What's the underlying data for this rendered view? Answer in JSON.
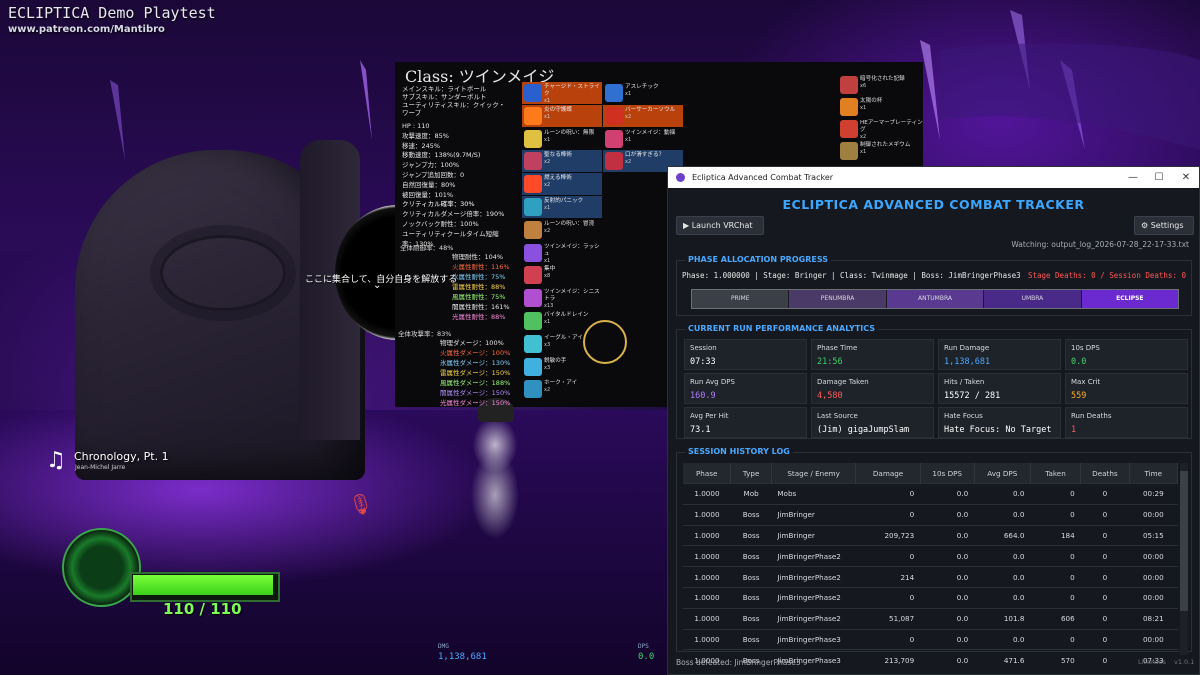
{
  "game": {
    "title": "ECLIPTICA Demo Playtest",
    "subtitle": "www.patreon.com/Mantibro",
    "class_title": "Class: ツインメイジ",
    "main_skill": "メインスキル：ライトボール",
    "sub_skill": "サブスキル：サンダーボルト",
    "utility_skill": "ユーティリティスキル：クイック・",
    "utility_skill_2": "ワープ",
    "stats": [
      "HP : 110",
      "攻撃速度：85%",
      "移速：245%",
      "移動速度：138%(9.7M/S)",
      "ジャンプ力：100%",
      "ジャンプ追加回数：0",
      "自然回復量：80%",
      "被回復量：101%",
      "クリティカル確率：30%",
      "クリティカルダメージ倍率：190%",
      "ノックバック耐性：100%",
      "ユーティリティクールタイム短縮",
      "率：130%"
    ],
    "defense_header": "全体耐御率：48%",
    "resistances": [
      {
        "label": "物理耐性：104%",
        "color": "#e6e6e6"
      },
      {
        "label": "火属性耐性：116%",
        "color": "#ff6a3d"
      },
      {
        "label": "氷属性耐性：75%",
        "color": "#7fd4ff"
      },
      {
        "label": "雷属性耐性：88%",
        "color": "#ffd94a"
      },
      {
        "label": "風属性耐性：75%",
        "color": "#9cff7a"
      },
      {
        "label": "闇属性耐性：161%",
        "color": "#e6e6e6"
      },
      {
        "label": "光属性耐性：88%",
        "color": "#ff8ae0"
      }
    ],
    "attack_header": "全体攻撃率：83%",
    "damages": [
      {
        "label": "物理ダメージ：100%",
        "color": "#e6e6e6"
      },
      {
        "label": "火属性ダメージ：100%",
        "color": "#ff6a3d"
      },
      {
        "label": "氷属性ダメージ：130%",
        "color": "#7fd4ff"
      },
      {
        "label": "雷属性ダメージ：150%",
        "color": "#ffd94a"
      },
      {
        "label": "風属性ダメージ：188%",
        "color": "#9cff7a"
      },
      {
        "label": "闇属性ダメージ：150%",
        "color": "#b08cff"
      },
      {
        "label": "光属性ダメージ：150%",
        "color": "#ff8ae0"
      }
    ],
    "sky_message": "ここに集合して、自分自身を解放する",
    "skills_left": [
      {
        "name": "チャージド・ストライク",
        "count": "x1",
        "hl": "hl-orange",
        "icon": "#2a5fd0"
      },
      {
        "name": "炎の守護蝶",
        "count": "x1",
        "hl": "hl-orange",
        "icon": "#ff7a1a"
      },
      {
        "name": "ルーンの呪い：無限",
        "count": "x1",
        "hl": "",
        "icon": "#e0c040"
      },
      {
        "name": "聖なる棒術",
        "count": "x2",
        "hl": "hl-blue",
        "icon": "#c04060"
      },
      {
        "name": "燃える棒術",
        "count": "x2",
        "hl": "hl-blue",
        "icon": "#ff4a2a"
      },
      {
        "name": "反射的パニック",
        "count": "x1",
        "hl": "hl-blue",
        "icon": "#30a0c0"
      },
      {
        "name": "ルーンの呪い：冒涜",
        "count": "x2",
        "hl": "",
        "icon": "#c08040"
      },
      {
        "name": "ツインメイジ：ラッシュ",
        "count": "x1",
        "hl": "",
        "icon": "#8a50e0"
      },
      {
        "name": "集中",
        "count": "x8",
        "hl": "",
        "icon": "#d04050"
      },
      {
        "name": "ツインメイジ：シニストラ",
        "count": "x13",
        "hl": "",
        "icon": "#b050d0"
      },
      {
        "name": "バイタルドレイン",
        "count": "x1",
        "hl": "",
        "icon": "#50c060"
      },
      {
        "name": "イーグル・アイ",
        "count": "x3",
        "hl": "",
        "icon": "#40c0d0"
      },
      {
        "name": "鋭敏の手",
        "count": "x3",
        "hl": "",
        "icon": "#40b0e0"
      },
      {
        "name": "ホーク・アイ",
        "count": "x2",
        "hl": "",
        "icon": "#3090c0"
      }
    ],
    "skills_right": [
      {
        "name": "アスレチック",
        "count": "x1",
        "hl": "",
        "icon": "#3070d0"
      },
      {
        "name": "バーサーカーソウル",
        "count": "x2",
        "hl": "hl-orange",
        "icon": "#d03020"
      },
      {
        "name": "ツインメイジ：動揺",
        "count": "x1",
        "hl": "",
        "icon": "#d04070"
      },
      {
        "name": "口が滑すぎる？",
        "count": "x2",
        "hl": "hl-blue",
        "icon": "#c03040"
      }
    ],
    "relics": [
      {
        "name": "暗号化された記録",
        "count": "x6",
        "icon": "#c04040"
      },
      {
        "name": "太陽の杯",
        "count": "x1",
        "icon": "#e08020"
      },
      {
        "name": "HEアーマープレーティング",
        "count": "x2",
        "icon": "#d04030"
      },
      {
        "name": "制御されたメギウム",
        "count": "x1",
        "icon": "#a08040"
      }
    ],
    "music": {
      "title": "Chronology, Pt. 1",
      "artist": "Jean-Michel Jarre"
    },
    "hp": {
      "current": 110,
      "max": 110,
      "text": "110 / 110"
    },
    "hud": {
      "dmg_label": "DMG",
      "dmg_value": "1,138,681",
      "dps_label": "DPS",
      "dps_value": "0.0"
    }
  },
  "tracker": {
    "window_title": "Ecliptica Advanced Combat Tracker",
    "app_title": "ECLIPTICA ADVANCED COMBAT TRACKER",
    "launch_button": "▶  Launch VRChat",
    "settings_button": "⚙  Settings",
    "watching": "Watching: output_log_2026-07-28_22-17-33.txt",
    "phase_section": {
      "title": "PHASE ALLOCATION PROGRESS",
      "info": "Phase: 1.000000 | Stage: Bringer | Class: Twinmage | Boss: JimBringerPhase3",
      "deaths": "Stage Deaths: 0 / Session Deaths: 0",
      "segments": [
        {
          "label": "PRIME",
          "color": "#3a3f48",
          "active": false
        },
        {
          "label": "PENUMBRA",
          "color": "#4a3a68",
          "active": false
        },
        {
          "label": "ANTUMBRA",
          "color": "#5a3a90",
          "active": false
        },
        {
          "label": "UMBRA",
          "color": "#4a2a88",
          "active": false
        },
        {
          "label": "ECLIPSE",
          "color": "#6a2ad0",
          "active": true
        }
      ]
    },
    "perf_section": {
      "title": "CURRENT RUN PERFORMANCE ANALYTICS",
      "cards": [
        {
          "label": "Session",
          "value": "07:33",
          "color": "#ffffff"
        },
        {
          "label": "Phase Time",
          "value": "21:56",
          "color": "#3fd36b"
        },
        {
          "label": "Run Damage",
          "value": "1,138,681",
          "color": "#4aa8ff"
        },
        {
          "label": "10s DPS",
          "value": "0.0",
          "color": "#3fd36b"
        },
        {
          "label": "Run Avg DPS",
          "value": "160.9",
          "color": "#b07cff"
        },
        {
          "label": "Damage Taken",
          "value": "4,580",
          "color": "#ff5a5a"
        },
        {
          "label": "Hits / Taken",
          "value": "15572 / 281",
          "color": "#ffffff"
        },
        {
          "label": "Max Crit",
          "value": "559",
          "color": "#ffb020"
        },
        {
          "label": "Avg Per Hit",
          "value": "73.1",
          "color": "#ffffff"
        },
        {
          "label": "Last Source",
          "value": "(Jim) gigaJumpSlam",
          "color": "#ffffff"
        },
        {
          "label": "Hate Focus",
          "value": "Hate Focus: No Target",
          "color": "#ffffff"
        },
        {
          "label": "Run Deaths",
          "value": "1",
          "color": "#ff5a5a"
        }
      ]
    },
    "history_section": {
      "title": "SESSION HISTORY LOG",
      "columns": [
        "Phase",
        "Type",
        "Stage / Enemy",
        "Damage",
        "10s DPS",
        "Avg DPS",
        "Taken",
        "Deaths",
        "Time"
      ],
      "rows": [
        [
          "1.0000",
          "Mob",
          "Mobs",
          "0",
          "0.0",
          "0.0",
          "0",
          "0",
          "00:29"
        ],
        [
          "1.0000",
          "Boss",
          "JimBringer",
          "0",
          "0.0",
          "0.0",
          "0",
          "0",
          "00:00"
        ],
        [
          "1.0000",
          "Boss",
          "JimBringer",
          "209,723",
          "0.0",
          "664.0",
          "184",
          "0",
          "05:15"
        ],
        [
          "1.0000",
          "Boss",
          "JimBringerPhase2",
          "0",
          "0.0",
          "0.0",
          "0",
          "0",
          "00:00"
        ],
        [
          "1.0000",
          "Boss",
          "JimBringerPhase2",
          "214",
          "0.0",
          "0.0",
          "0",
          "0",
          "00:00"
        ],
        [
          "1.0000",
          "Boss",
          "JimBringerPhase2",
          "0",
          "0.0",
          "0.0",
          "0",
          "0",
          "00:00"
        ],
        [
          "1.0000",
          "Boss",
          "JimBringerPhase2",
          "51,087",
          "0.0",
          "101.8",
          "606",
          "0",
          "08:21"
        ],
        [
          "1.0000",
          "Boss",
          "JimBringerPhase3",
          "0",
          "0.0",
          "0.0",
          "0",
          "0",
          "00:00"
        ],
        [
          "1.0000",
          "Boss",
          "JimBringerPhase3",
          "213,709",
          "0.0",
          "471.6",
          "570",
          "0",
          "07:33"
        ]
      ]
    },
    "status": "Boss defeated: JimBringerPhase3",
    "licenses": "Licenses",
    "version": "v1.0.1"
  }
}
